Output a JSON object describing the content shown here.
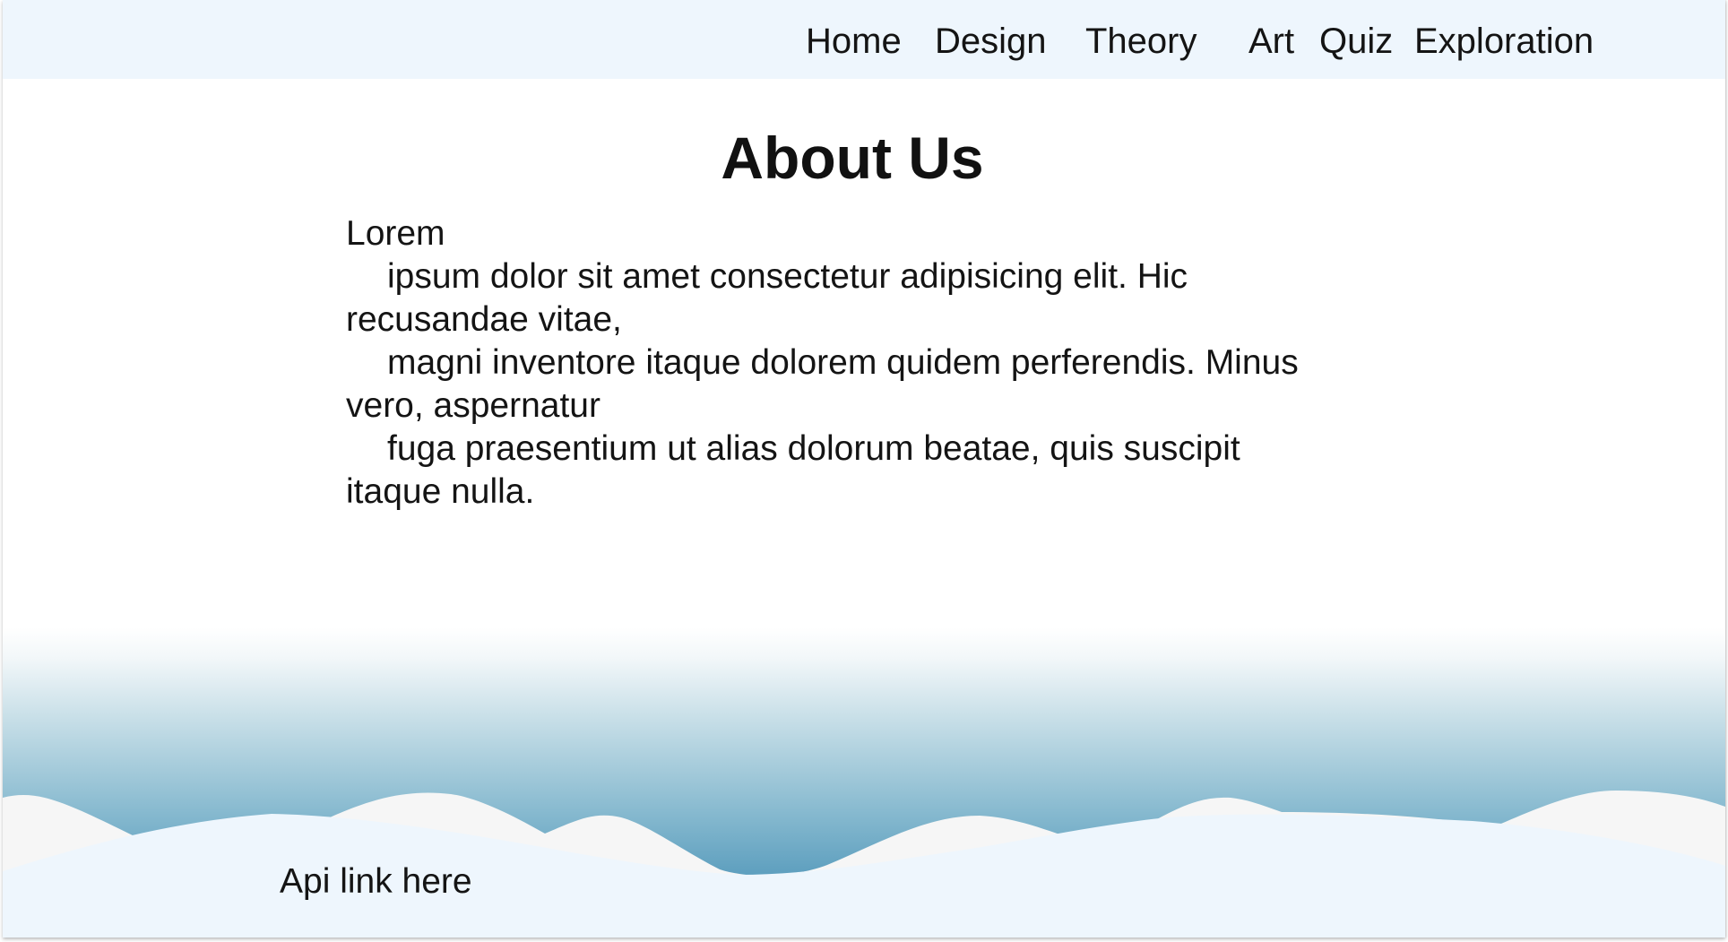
{
  "nav": {
    "items": [
      {
        "label": "Home"
      },
      {
        "label": "Design"
      },
      {
        "label": "Theory"
      },
      {
        "label": "Art"
      },
      {
        "label": "Quiz"
      },
      {
        "label": "Exploration"
      }
    ]
  },
  "main": {
    "title": "About Us",
    "paragraph_lines": [
      "Lorem",
      "ipsum dolor sit amet consectetur adipisicing elit. Hic",
      "recusandae vitae,",
      "magni inventore itaque dolorem quidem perferendis. Minus",
      "vero, aspernatur",
      "fuga praesentium ut alias dolorum beatae, quis suscipit",
      "itaque nulla."
    ]
  },
  "footer": {
    "api_link": "Api link here"
  },
  "colors": {
    "nav_background": "#eef6fd",
    "wave_dark": "#3a8cb0",
    "wave_light": "#f6f6f6",
    "footer_background": "#eef6fd"
  }
}
